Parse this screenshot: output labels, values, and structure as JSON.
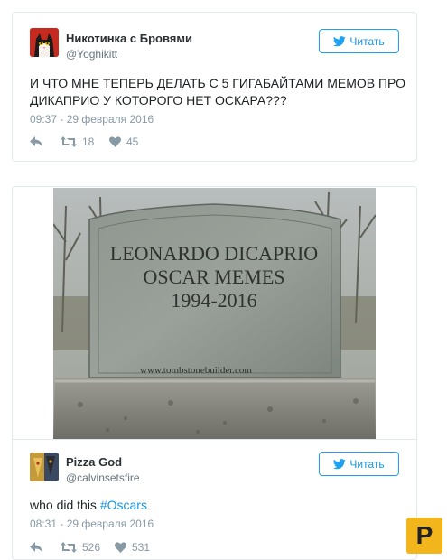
{
  "tweet1": {
    "author_name": "Никотинка с Бровями",
    "handle": "@Yoghikitt",
    "follow_label": "Читать",
    "text_line1": "И ЧТО МНЕ ТЕПЕРЬ ДЕЛАТЬ С 5 ГИГАБАЙТАМИ МЕМОВ ПРО",
    "text_line2": "ДИКАПРИО У КОТОРОГО НЕТ ОСКАРА???",
    "timestamp": "09:37 - 29 февраля 2016",
    "retweets": "18",
    "likes": "45",
    "icons": [
      "reply-icon",
      "retweet-icon",
      "heart-icon",
      "twitter-bird-icon"
    ]
  },
  "tombstone": {
    "line1": "LEONARDO DICAPRIO",
    "line2": "OSCAR MEMES",
    "line3": "1994-2016",
    "website": "www.tombstonebuilder.com"
  },
  "tweet2": {
    "author_name": "Pizza God",
    "handle": "@calvinsetsfire",
    "follow_label": "Читать",
    "text_plain": "who did this ",
    "hashtag": "#Oscars",
    "timestamp": "08:31 - 29 февраля 2016",
    "retweets": "526",
    "likes": "531"
  },
  "site_logo": {
    "letter": "P",
    "color": "#f3b51c"
  },
  "colors": {
    "accent": "#1da1f2",
    "muted": "#8899a6",
    "border": "#e1e8ed"
  }
}
